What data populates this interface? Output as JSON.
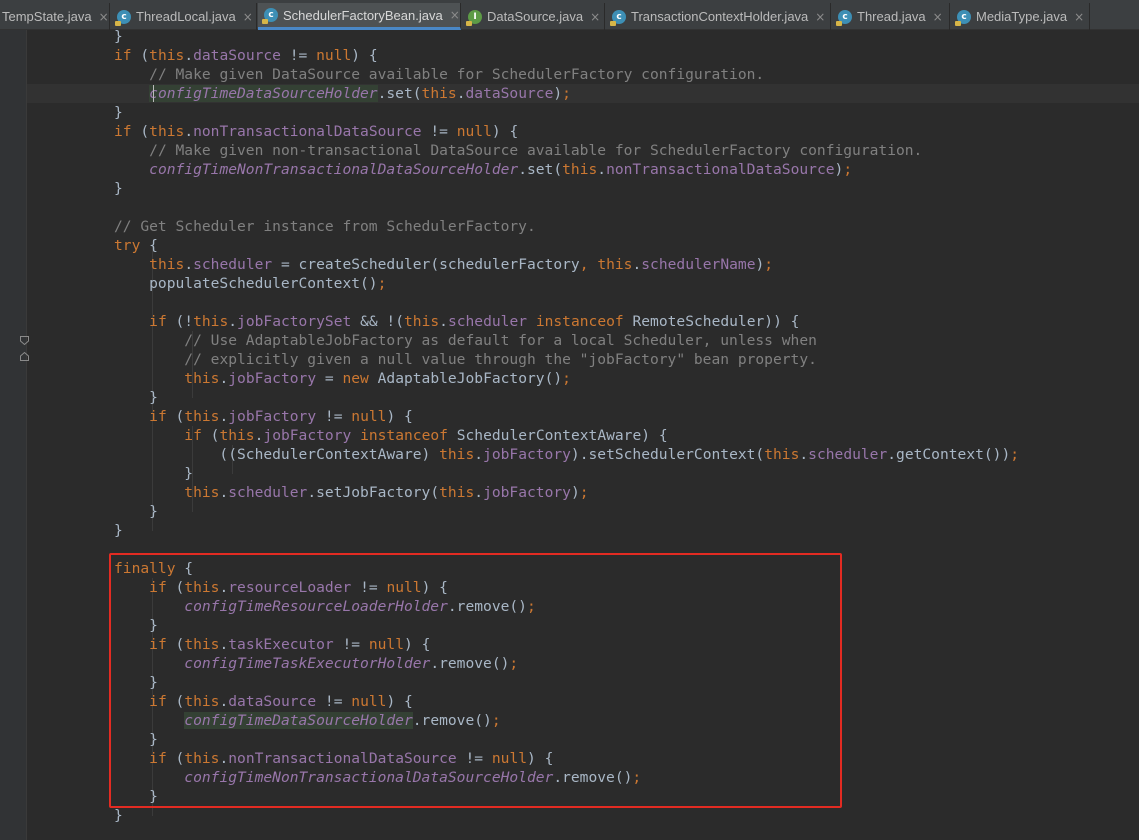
{
  "tabs": [
    {
      "label": "TempState.java",
      "icon": "class-icon",
      "active": false
    },
    {
      "label": "ThreadLocal.java",
      "icon": "class-icon",
      "active": false
    },
    {
      "label": "SchedulerFactoryBean.java",
      "icon": "class-icon",
      "active": true
    },
    {
      "label": "DataSource.java",
      "icon": "interface-icon",
      "active": false
    },
    {
      "label": "TransactionContextHolder.java",
      "icon": "class-icon",
      "active": false
    },
    {
      "label": "Thread.java",
      "icon": "class-icon",
      "active": false
    },
    {
      "label": "MediaType.java",
      "icon": "class-icon",
      "active": false
    }
  ],
  "close_glyph": "×",
  "colors": {
    "keyword": "#cc7832",
    "field": "#9876aa",
    "comment": "#808080",
    "text": "#a9b7c6",
    "background": "#2b2b2b",
    "highlight_box": "#e32b22"
  },
  "code_lines": [
    "}",
    "if (this.dataSource != null) {",
    "    // Make given DataSource available for SchedulerFactory configuration.",
    "    configTimeDataSourceHolder.set(this.dataSource);",
    "}",
    "if (this.nonTransactionalDataSource != null) {",
    "    // Make given non-transactional DataSource available for SchedulerFactory configuration.",
    "    configTimeNonTransactionalDataSourceHolder.set(this.nonTransactionalDataSource);",
    "}",
    "",
    "// Get Scheduler instance from SchedulerFactory.",
    "try {",
    "    this.scheduler = createScheduler(schedulerFactory, this.schedulerName);",
    "    populateSchedulerContext();",
    "",
    "    if (!this.jobFactorySet && !(this.scheduler instanceof RemoteScheduler)) {",
    "        // Use AdaptableJobFactory as default for a local Scheduler, unless when",
    "        // explicitly given a null value through the \"jobFactory\" bean property.",
    "        this.jobFactory = new AdaptableJobFactory();",
    "    }",
    "    if (this.jobFactory != null) {",
    "        if (this.jobFactory instanceof SchedulerContextAware) {",
    "            ((SchedulerContextAware) this.jobFactory).setSchedulerContext(this.scheduler.getContext());",
    "        }",
    "        this.scheduler.setJobFactory(this.jobFactory);",
    "    }",
    "}",
    "",
    "finally {",
    "    if (this.resourceLoader != null) {",
    "        configTimeResourceLoaderHolder.remove();",
    "    }",
    "    if (this.taskExecutor != null) {",
    "        configTimeTaskExecutorHolder.remove();",
    "    }",
    "    if (this.dataSource != null) {",
    "        configTimeDataSourceHolder.remove();",
    "    }",
    "    if (this.nonTransactionalDataSource != null) {",
    "        configTimeNonTransactionalDataSourceHolder.remove();",
    "    }",
    "}"
  ]
}
